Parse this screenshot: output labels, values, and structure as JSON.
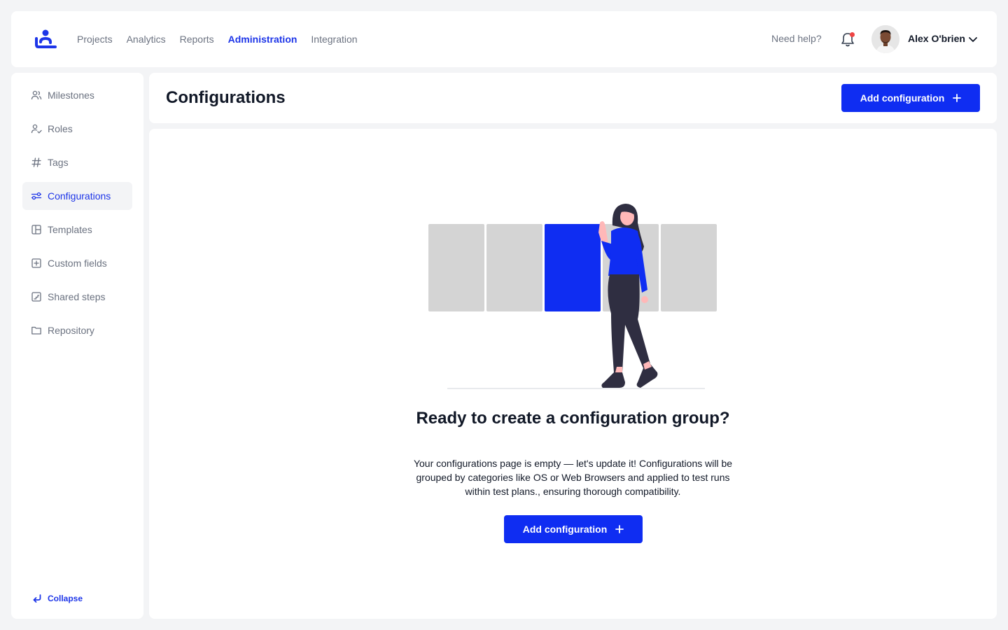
{
  "nav": {
    "items": [
      {
        "label": "Projects",
        "active": false
      },
      {
        "label": "Analytics",
        "active": false
      },
      {
        "label": "Reports",
        "active": false
      },
      {
        "label": "Administration",
        "active": true
      },
      {
        "label": "Integration",
        "active": false
      }
    ],
    "help": "Need help?",
    "user_name": "Alex O'brien",
    "notification_unread": true
  },
  "sidebar": {
    "items": [
      {
        "label": "Milestones",
        "icon": "users-icon"
      },
      {
        "label": "Roles",
        "icon": "user-check-icon"
      },
      {
        "label": "Tags",
        "icon": "hash-icon"
      },
      {
        "label": "Configurations",
        "icon": "sliders-icon",
        "active": true
      },
      {
        "label": "Templates",
        "icon": "layout-icon"
      },
      {
        "label": "Custom fields",
        "icon": "plus-square-icon"
      },
      {
        "label": "Shared steps",
        "icon": "steps-icon"
      },
      {
        "label": "Repository",
        "icon": "folder-icon"
      }
    ],
    "collapse": "Collapse"
  },
  "header": {
    "title": "Configurations",
    "add_button": "Add configuration"
  },
  "empty_state": {
    "title": "Ready to create a configuration group?",
    "description": "Your configurations page is empty — let's update it! Configurations will be grouped by categories like OS or Web Browsers and applied to test runs within test plans., ensuring thorough compatibility.",
    "add_button": "Add configuration"
  },
  "colors": {
    "accent": "#0f2df2",
    "active_text": "#1d35e8",
    "muted": "#6b7280",
    "background": "#f3f4f6",
    "notification_dot": "#ef4444"
  }
}
